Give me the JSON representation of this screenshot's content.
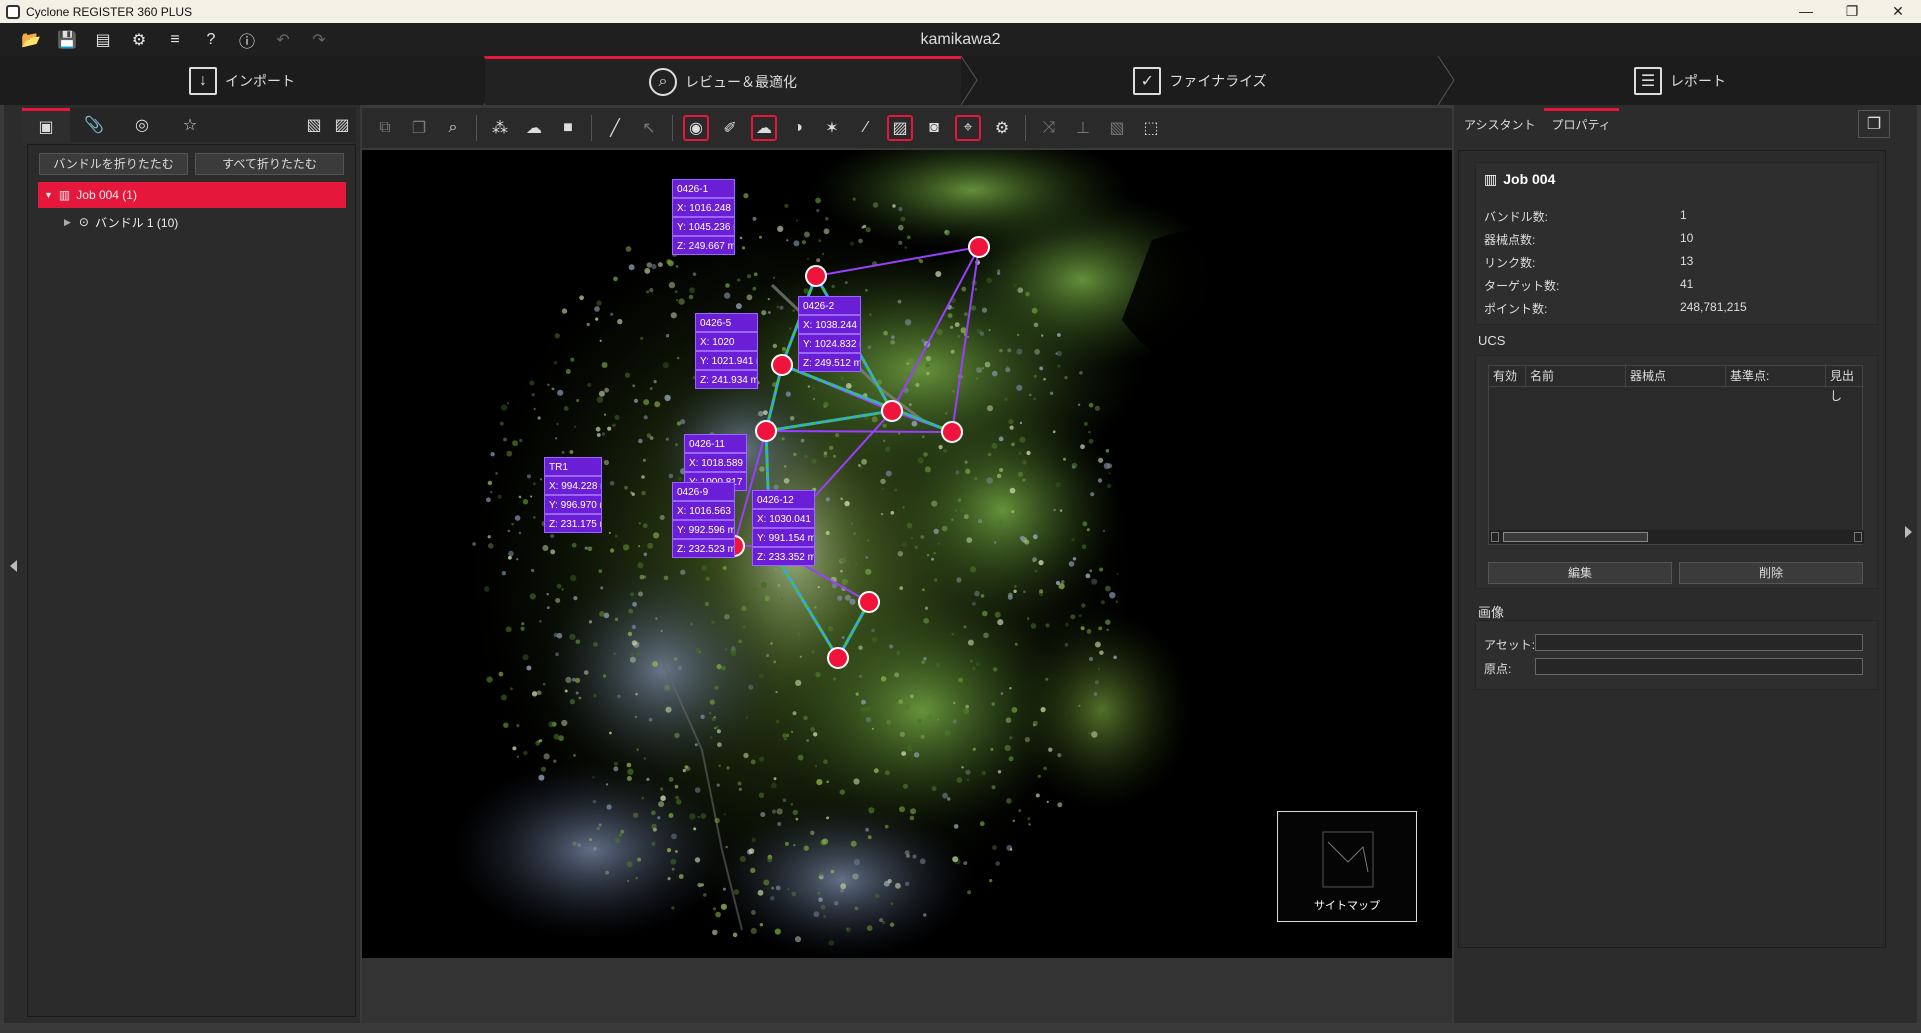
{
  "app": {
    "title": "Cyclone REGISTER 360 PLUS",
    "document_title": "kamikawa2",
    "window_buttons": [
      "—",
      "❐",
      "✕"
    ]
  },
  "toolbar_icons": [
    "folder-open-icon",
    "folder-save-icon",
    "book-icon",
    "gear-icon",
    "database-icon",
    "help-icon",
    "info-icon",
    "undo-icon",
    "redo-icon"
  ],
  "workflow": {
    "steps": [
      {
        "label": "インポート",
        "icon": "import-icon"
      },
      {
        "label": "レビュー＆最適化",
        "icon": "review-icon"
      },
      {
        "label": "ファイナライズ",
        "icon": "finalize-icon"
      },
      {
        "label": "レポート",
        "icon": "report-icon"
      }
    ],
    "active": 1
  },
  "left_panel": {
    "collapse_bundles": "バンドルを折りたたむ",
    "collapse_all": "すべて折りたたむ",
    "tree": [
      {
        "label": "Job 004 (1)",
        "selected": true
      },
      {
        "label": "バンドル 1 (10)",
        "selected": false
      }
    ]
  },
  "viewport": {
    "sitemap_label": "サイトマップ",
    "setups": [
      {
        "id": "0426-1",
        "x": "X: 1016.248 m",
        "y": "Y: 1045.236 m",
        "z": "Z: 249.667 m"
      },
      {
        "id": "0426-2",
        "x": "X: 1038.244 m",
        "y": "Y: 1024.832 m",
        "z": "Z: 249.512 m"
      },
      {
        "id": "0426-5",
        "x": "X: 1020",
        "x_suffix": "m",
        "y": "Y: 1021.941 m",
        "z": "Z: 241.934 m"
      },
      {
        "id": "0426-11",
        "x": "X: 1018.589 m",
        "y": "Y: 1000.817",
        "z": ""
      },
      {
        "id": "TR1",
        "x": "X: 994.228 m",
        "y": "Y: 996.970 m",
        "z": "Z: 231.175 m"
      },
      {
        "id": "0426-9",
        "x": "X: 1016.563 m",
        "y": "Y: 992.596 m",
        "z": "Z: 232.523 m"
      },
      {
        "id": "0426-12",
        "x": "X: 1030.041 m",
        "y": "Y: 991.154 m",
        "z": "Z: 233.352 m"
      }
    ]
  },
  "right_panel": {
    "tabs": [
      "アシスタント",
      "プロパティ"
    ],
    "active_tab": 1,
    "job_title": "Job 004",
    "props": [
      {
        "label": "バンドル数:",
        "value": "1"
      },
      {
        "label": "器械点数:",
        "value": "10"
      },
      {
        "label": "リンク数:",
        "value": "13"
      },
      {
        "label": "ターゲット数:",
        "value": "41"
      },
      {
        "label": "ポイント数:",
        "value": "248,781,215"
      }
    ],
    "ucs_heading": "UCS",
    "ucs_columns": [
      "有効",
      "名前",
      "器械点",
      "基準点:",
      "見出し"
    ],
    "edit_button": "編集",
    "delete_button": "削除",
    "image_heading": "画像",
    "asset_label": "アセット:",
    "origin_label": "原点:"
  }
}
